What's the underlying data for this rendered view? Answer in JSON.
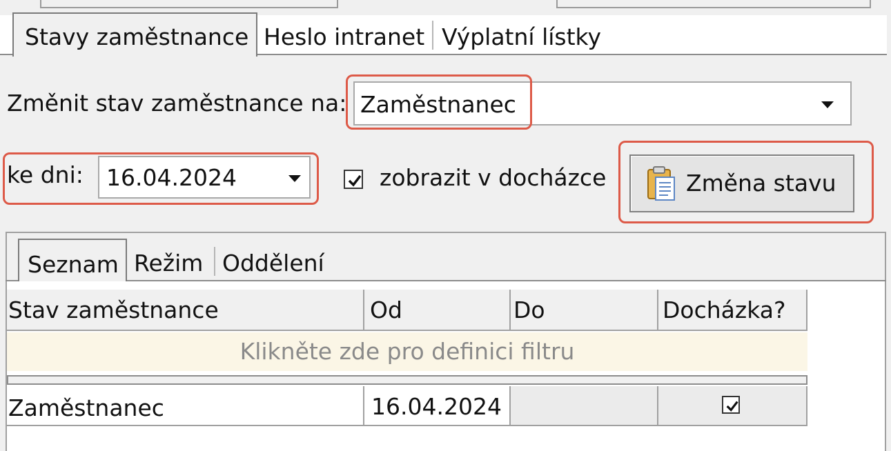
{
  "top_tabs": [
    "Stavy zaměstnance",
    "Heslo intranet",
    "Výplatní lístky"
  ],
  "status_label": "Změnit stav zaměstnance na:",
  "status_value": "Zaměstnanec",
  "date_label": "ke dni:",
  "date_value": "16.04.2024",
  "show_attendance_label": "zobrazit v docházce",
  "show_attendance_checked": true,
  "change_button_label": "Změna stavu",
  "inner_tabs": [
    "Seznam",
    "Režim",
    "Oddělení"
  ],
  "grid": {
    "columns": [
      "Stav zaměstnance",
      "Od",
      "Do",
      "Docházka?"
    ],
    "filter_text": "Klikněte zde pro definici filtru",
    "rows": [
      {
        "status": "Zaměstnanec",
        "from": "16.04.2024",
        "to": "",
        "attendance": true
      }
    ]
  },
  "colors": {
    "highlight": "#dd5a48",
    "filter_row": "#fbf6e6"
  }
}
